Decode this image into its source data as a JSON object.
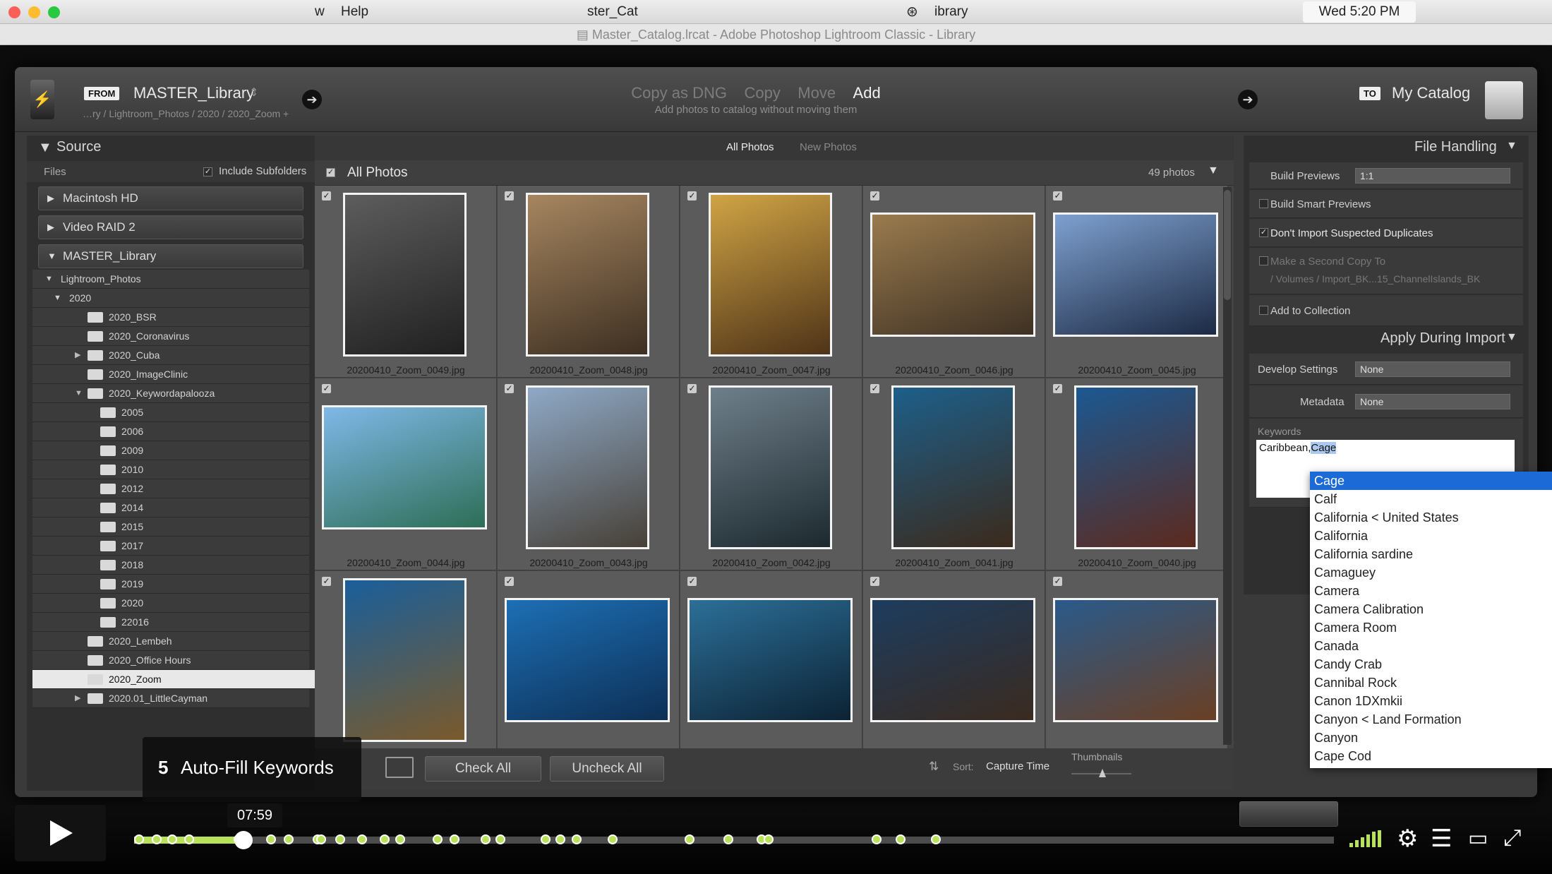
{
  "menubar": {
    "left_fragment": "w",
    "help": "Help",
    "center_fragment": "ster_Cat",
    "library_fragment": "ibrary",
    "clock": "Wed 5:20 PM"
  },
  "window": {
    "title": "Master_Catalog.lrcat - Adobe Photoshop Lightroom Classic - Library"
  },
  "import": {
    "from_tag": "FROM",
    "from_name": "MASTER_Library",
    "from_path": "…ry / Lightroom_Photos / 2020 / 2020_Zoom +",
    "modes": [
      "Copy as DNG",
      "Copy",
      "Move",
      "Add"
    ],
    "active_mode": "Add",
    "mode_desc": "Add photos to catalog without moving them",
    "to_tag": "TO",
    "to_name": "My Catalog"
  },
  "source": {
    "header": "Source",
    "files_label": "Files",
    "include_subfolders": "Include Subfolders",
    "drives": [
      "Macintosh HD",
      "Video RAID 2",
      "MASTER_Library"
    ],
    "tree_root": "Lightroom_Photos",
    "year": "2020",
    "folders": [
      {
        "name": "2020_BSR",
        "depth": 1,
        "exp": ""
      },
      {
        "name": "2020_Coronavirus",
        "depth": 1,
        "exp": ""
      },
      {
        "name": "2020_Cuba",
        "depth": 1,
        "exp": "▶"
      },
      {
        "name": "2020_ImageClinic",
        "depth": 1,
        "exp": ""
      },
      {
        "name": "2020_Keywordapalooza",
        "depth": 1,
        "exp": "▼"
      },
      {
        "name": "2005",
        "depth": 2,
        "exp": ""
      },
      {
        "name": "2006",
        "depth": 2,
        "exp": ""
      },
      {
        "name": "2009",
        "depth": 2,
        "exp": ""
      },
      {
        "name": "2010",
        "depth": 2,
        "exp": ""
      },
      {
        "name": "2012",
        "depth": 2,
        "exp": ""
      },
      {
        "name": "2014",
        "depth": 2,
        "exp": ""
      },
      {
        "name": "2015",
        "depth": 2,
        "exp": ""
      },
      {
        "name": "2017",
        "depth": 2,
        "exp": ""
      },
      {
        "name": "2018",
        "depth": 2,
        "exp": ""
      },
      {
        "name": "2019",
        "depth": 2,
        "exp": ""
      },
      {
        "name": "2020",
        "depth": 2,
        "exp": ""
      },
      {
        "name": "22016",
        "depth": 2,
        "exp": ""
      },
      {
        "name": "2020_Lembeh",
        "depth": 1,
        "exp": ""
      },
      {
        "name": "2020_Office Hours",
        "depth": 1,
        "exp": ""
      },
      {
        "name": "2020_Zoom",
        "depth": 1,
        "exp": "",
        "selected": true
      },
      {
        "name": "2020.01_LittleCayman",
        "depth": 1,
        "exp": "▶"
      }
    ]
  },
  "grid": {
    "tabs": [
      "All Photos",
      "New Photos"
    ],
    "header": "All Photos",
    "count": "49 photos",
    "photos": [
      {
        "file": "20200410_Zoom_0049.jpg",
        "c1": "#5d5d5d",
        "c2": "#202020",
        "portrait": true
      },
      {
        "file": "20200410_Zoom_0048.jpg",
        "c1": "#a68660",
        "c2": "#3d2f22",
        "portrait": true
      },
      {
        "file": "20200410_Zoom_0047.jpg",
        "c1": "#d0a445",
        "c2": "#4e3318",
        "portrait": true
      },
      {
        "file": "20200410_Zoom_0046.jpg",
        "c1": "#9a7b4e",
        "c2": "#3e3124",
        "portrait": false
      },
      {
        "file": "20200410_Zoom_0045.jpg",
        "c1": "#7ea0cf",
        "c2": "#1c2a44",
        "portrait": false
      },
      {
        "file": "20200410_Zoom_0044.jpg",
        "c1": "#7fb8e8",
        "c2": "#2d6e55",
        "portrait": false
      },
      {
        "file": "20200410_Zoom_0043.jpg",
        "c1": "#8fa9c6",
        "c2": "#474037",
        "portrait": true
      },
      {
        "file": "20200410_Zoom_0042.jpg",
        "c1": "#6f7f8a",
        "c2": "#1c2a2f",
        "portrait": true
      },
      {
        "file": "20200410_Zoom_0041.jpg",
        "c1": "#1d5f8a",
        "c2": "#3b2a1c",
        "portrait": true
      },
      {
        "file": "20200410_Zoom_0040.jpg",
        "c1": "#1b5892",
        "c2": "#5c2a1e",
        "portrait": true
      },
      {
        "file": "",
        "c1": "#1a5f9a",
        "c2": "#7a5a2c",
        "portrait": true
      },
      {
        "file": "",
        "c1": "#1d6fb4",
        "c2": "#0d2f55",
        "portrait": false
      },
      {
        "file": "",
        "c1": "#2c6f98",
        "c2": "#0c2233",
        "portrait": false
      },
      {
        "file": "",
        "c1": "#1d3c5e",
        "c2": "#3a2a1f",
        "portrait": false
      },
      {
        "file": "",
        "c1": "#2a5a8a",
        "c2": "#6a3f24",
        "portrait": false
      }
    ]
  },
  "file_handling": {
    "header": "File Handling",
    "build_previews_label": "Build Previews",
    "build_previews_value": "1:1",
    "smart_previews": "Build Smart Previews",
    "no_dupes": "Don't Import Suspected Duplicates",
    "second_copy": "Make a Second Copy To",
    "second_copy_path": "/ Volumes / Import_BK...15_ChannelIslands_BK",
    "add_collection": "Add to Collection"
  },
  "apply": {
    "header": "Apply During Import",
    "develop_label": "Develop Settings",
    "develop_value": "None",
    "metadata_label": "Metadata",
    "metadata_value": "None",
    "keywords_label": "Keywords",
    "keywords_prefix": "Caribbean,",
    "keywords_sel": "Cage"
  },
  "autocomplete": [
    "Cage",
    "Calf",
    "California < United States",
    "California",
    "California sardine",
    "Camaguey",
    "Camera",
    "Camera Calibration",
    "Camera Room",
    "Canada",
    "Candy Crab",
    "Cannibal Rock",
    "Canon 1DXmkii",
    "Canyon < Land Formation",
    "Canyon",
    "Cape Cod"
  ],
  "bottom": {
    "check_all": "Check All",
    "uncheck_all": "Uncheck All",
    "sort_label": "Sort:",
    "sort_value": "Capture Time",
    "thumbnails": "Thumbnails"
  },
  "caption": {
    "number": "5",
    "text": "Auto-Fill Keywords"
  },
  "player": {
    "time": "07:59",
    "progress": 0.091
  },
  "colors": {
    "accent": "#b8e25a",
    "highlight": "#1b6ad6"
  }
}
